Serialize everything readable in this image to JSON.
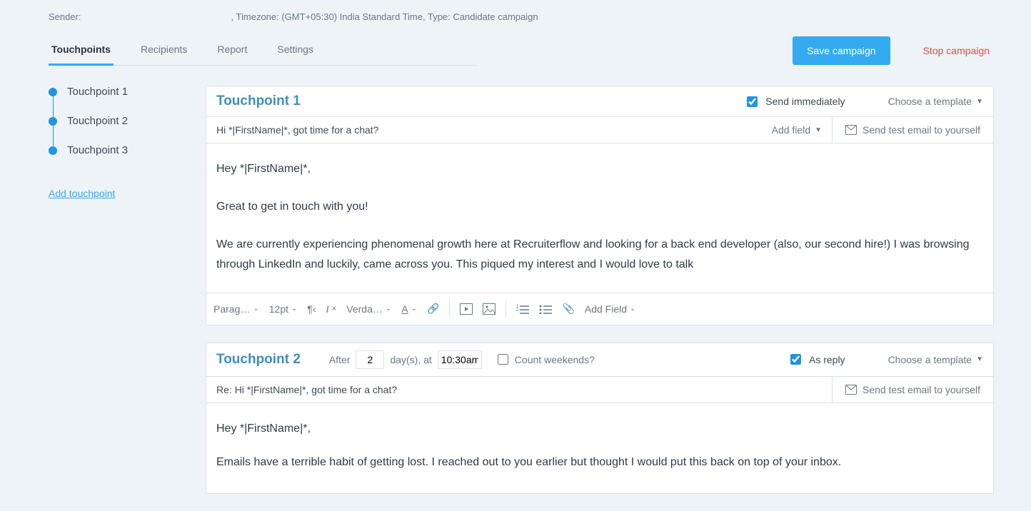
{
  "meta": {
    "sender_label": "Sender:",
    "timezone": ", Timezone: (GMT+05:30) India Standard Time, Type: Candidate campaign"
  },
  "tabs": {
    "touchpoints": "Touchpoints",
    "recipients": "Recipients",
    "report": "Report",
    "settings": "Settings"
  },
  "actions": {
    "save": "Save campaign",
    "stop": "Stop campaign"
  },
  "sidebar": {
    "items": [
      "Touchpoint 1",
      "Touchpoint 2",
      "Touchpoint 3"
    ],
    "add": "Add touchpoint"
  },
  "tp1": {
    "title": "Touchpoint 1",
    "send_immediately": "Send immediately",
    "choose_template": "Choose a template",
    "subject": "Hi *|FirstName|*, got time for a chat?",
    "add_field": "Add field",
    "send_test": "Send test email to yourself",
    "body_l1": "Hey *|FirstName|*,",
    "body_l2": "Great to get in touch with you!",
    "body_l3": "We are currently experiencing phenomenal growth here at Recruiterflow and looking for a back end developer (also, our second hire!) I was browsing through LinkedIn and luckily, came across you. This piqued my interest and I would love to talk"
  },
  "toolbar": {
    "paragraph": "Parag…",
    "fontsize": "12pt",
    "font": "Verda…",
    "addfield": "Add Field"
  },
  "tp2": {
    "title": "Touchpoint 2",
    "after": "After",
    "days_value": "2",
    "days_label": "day(s), at",
    "time_value": "10:30am",
    "count_weekends": "Count weekends?",
    "as_reply": "As reply",
    "choose_template": "Choose a template",
    "subject": "Re: Hi *|FirstName|*, got time for a chat?",
    "send_test": "Send test email to yourself",
    "body_l1": "Hey *|FirstName|*,",
    "body_l2": "Emails have a terrible habit of getting lost. I reached out to you earlier but thought I would put this back on top of your inbox."
  }
}
